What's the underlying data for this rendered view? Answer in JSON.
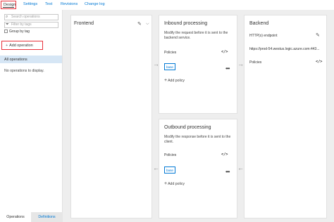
{
  "tabs": [
    "Design",
    "Settings",
    "Test",
    "Revisions",
    "Change log"
  ],
  "left_panel": {
    "search_placeholder": "Search operations",
    "filter_placeholder": "Filter by tags",
    "group_by_tag": "Group by tag",
    "add_operation": "Add operation",
    "all_operations": "All operations",
    "empty_message": "No operations to display.",
    "bottom_tabs": [
      "Operations",
      "Definitions"
    ]
  },
  "frontend": {
    "title": "Frontend"
  },
  "inbound": {
    "title": "Inbound processing",
    "description": "Modify the request before it is sent to the backend service.",
    "policies_label": "Policies",
    "code_icon": "</>",
    "base_tag": "base",
    "add_policy": "Add policy"
  },
  "outbound": {
    "title": "Outbound processing",
    "description": "Modify the response before it is sent to the client.",
    "policies_label": "Policies",
    "code_icon": "</>",
    "base_tag": "base",
    "add_policy": "Add policy"
  },
  "backend": {
    "title": "Backend",
    "endpoint_label": "HTTP(s) endpoint",
    "endpoint_url": "https://prod-54.westus.logic.azure.com:443...",
    "policies_label": "Policies",
    "code_icon": "</>"
  },
  "colors": {
    "accent": "#0078d4",
    "highlight": "#e8323c",
    "canvas": "#eeeeee",
    "selected_row": "#d6e6f5"
  }
}
